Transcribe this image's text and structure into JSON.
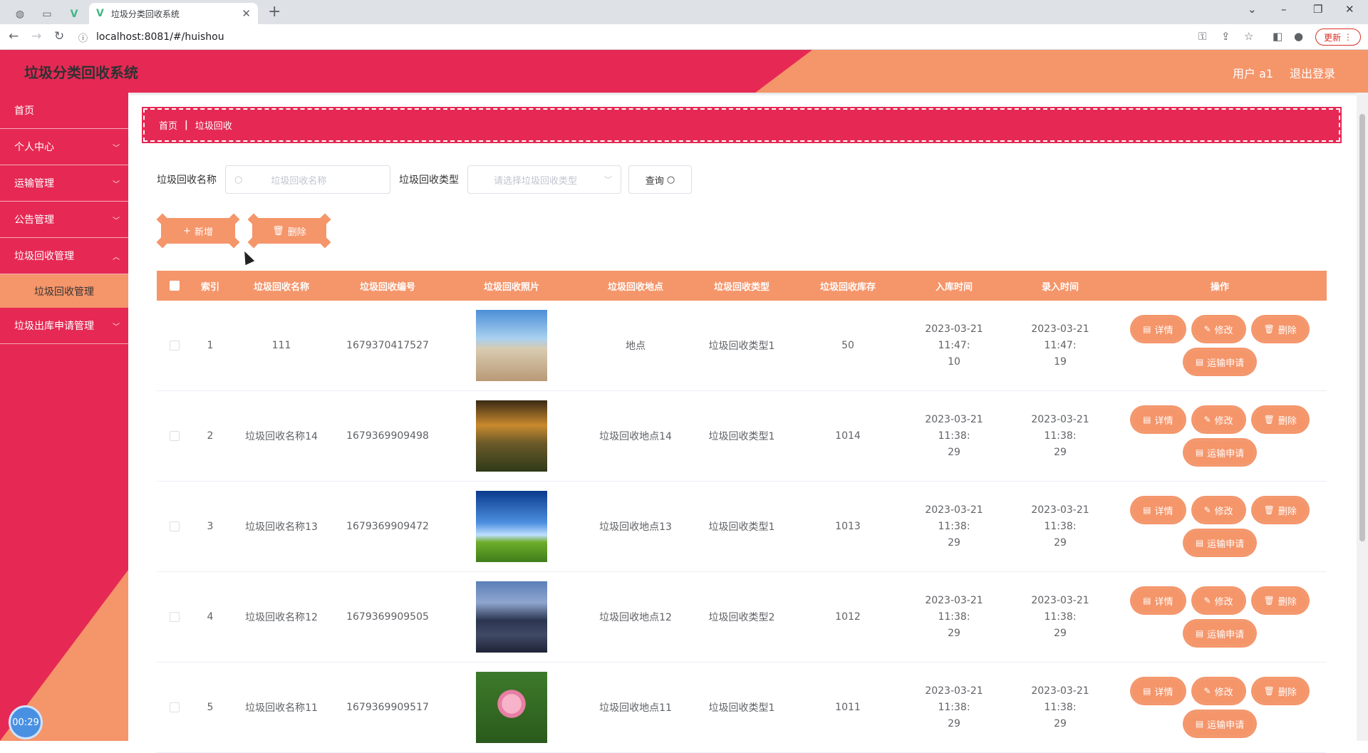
{
  "browser": {
    "tab_title": "垃圾分类回收系统",
    "url": "localhost:8081/#/huishou",
    "update_label": "更新"
  },
  "header": {
    "title": "垃圾分类回收系统",
    "user_label": "用户 a1",
    "logout_label": "退出登录"
  },
  "sidebar": {
    "items": [
      {
        "label": "首页"
      },
      {
        "label": "个人中心"
      },
      {
        "label": "运输管理"
      },
      {
        "label": "公告管理"
      },
      {
        "label": "垃圾回收管理"
      },
      {
        "label": "垃圾出库申请管理"
      }
    ],
    "sub_item": "垃圾回收管理",
    "timer": "00:29"
  },
  "breadcrumb": {
    "home": "首页",
    "sep": "|",
    "current": "垃圾回收"
  },
  "search": {
    "name_label": "垃圾回收名称",
    "name_placeholder": "垃圾回收名称",
    "type_label": "垃圾回收类型",
    "type_placeholder": "请选择垃圾回收类型",
    "query_label": "查询"
  },
  "actions": {
    "add_label": "新增",
    "delete_label": "删除"
  },
  "table": {
    "headers": {
      "index": "索引",
      "name": "垃圾回收名称",
      "code": "垃圾回收编号",
      "photo": "垃圾回收照片",
      "location": "垃圾回收地点",
      "type": "垃圾回收类型",
      "stock": "垃圾回收库存",
      "in_time": "入库时间",
      "record_time": "录入时间",
      "ops": "操作"
    },
    "op_labels": {
      "detail": "详情",
      "edit": "修改",
      "delete": "删除",
      "transport": "运输申请"
    },
    "rows": [
      {
        "index": "1",
        "name": "111",
        "code": "1679370417527",
        "location": "地点",
        "type": "垃圾回收类型1",
        "stock": "50",
        "in_time_1": "2023-03-21 11:47:",
        "in_time_2": "10",
        "rec_time_1": "2023-03-21 11:47:",
        "rec_time_2": "19",
        "photo": "road"
      },
      {
        "index": "2",
        "name": "垃圾回收名称14",
        "code": "1679369909498",
        "location": "垃圾回收地点14",
        "type": "垃圾回收类型1",
        "stock": "1014",
        "in_time_1": "2023-03-21 11:38:",
        "in_time_2": "29",
        "rec_time_1": "2023-03-21 11:38:",
        "rec_time_2": "29",
        "photo": "sunset"
      },
      {
        "index": "3",
        "name": "垃圾回收名称13",
        "code": "1679369909472",
        "location": "垃圾回收地点13",
        "type": "垃圾回收类型1",
        "stock": "1013",
        "in_time_1": "2023-03-21 11:38:",
        "in_time_2": "29",
        "rec_time_1": "2023-03-21 11:38:",
        "rec_time_2": "29",
        "photo": "sky"
      },
      {
        "index": "4",
        "name": "垃圾回收名称12",
        "code": "1679369909505",
        "location": "垃圾回收地点12",
        "type": "垃圾回收类型2",
        "stock": "1012",
        "in_time_1": "2023-03-21 11:38:",
        "in_time_2": "29",
        "rec_time_1": "2023-03-21 11:38:",
        "rec_time_2": "29",
        "photo": "city"
      },
      {
        "index": "5",
        "name": "垃圾回收名称11",
        "code": "1679369909517",
        "location": "垃圾回收地点11",
        "type": "垃圾回收类型1",
        "stock": "1011",
        "in_time_1": "2023-03-21 11:38:",
        "in_time_2": "29",
        "rec_time_1": "2023-03-21 11:38:",
        "rec_time_2": "29",
        "photo": "lotus"
      }
    ]
  },
  "colors": {
    "primary_red": "#e62954",
    "accent_orange": "#f5956a"
  }
}
